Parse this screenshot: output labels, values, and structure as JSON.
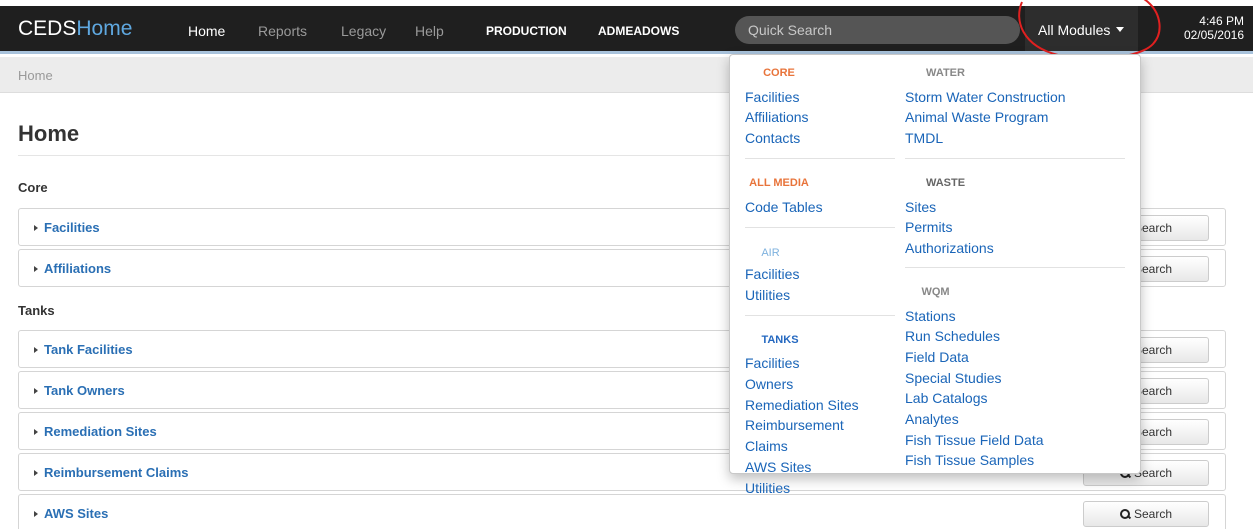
{
  "brand": {
    "part1": "CEDS",
    "part2": "Home"
  },
  "nav": {
    "home": "Home",
    "reports": "Reports",
    "legacy": "Legacy",
    "help": "Help",
    "environment": "PRODUCTION",
    "user": "ADMEADOWS"
  },
  "search": {
    "placeholder": "Quick Search"
  },
  "modules": {
    "label": "All Modules"
  },
  "clock": {
    "time": "4:46 PM",
    "date": "02/05/2016"
  },
  "breadcrumb": "Home",
  "page": {
    "title": "Home",
    "sections": [
      {
        "label": "Core",
        "panels": [
          "Facilities",
          "Affiliations"
        ]
      },
      {
        "label": "Tanks",
        "panels": [
          "Tank Facilities",
          "Tank Owners",
          "Remediation Sites",
          "Reimbursement Claims",
          "AWS Sites"
        ]
      }
    ],
    "search_button": "Search"
  },
  "dropdown": {
    "core": {
      "title": "CORE",
      "items": [
        "Facilities",
        "Affiliations",
        "Contacts"
      ]
    },
    "all_media": {
      "title": "ALL MEDIA",
      "items": [
        "Code Tables"
      ]
    },
    "air": {
      "title": "AIR",
      "items": [
        "Facilities",
        "Utilities"
      ]
    },
    "tanks": {
      "title": "TANKS",
      "items": [
        "Facilities",
        "Owners",
        "Remediation Sites",
        "Reimbursement",
        "Claims",
        "AWS Sites",
        "Utilities"
      ]
    },
    "water": {
      "title": "WATER",
      "items": [
        "Storm Water Construction",
        "Animal Waste Program",
        "TMDL"
      ]
    },
    "waste": {
      "title": "WASTE",
      "items": [
        "Sites",
        "Permits",
        "Authorizations"
      ]
    },
    "wqm": {
      "title": "WQM",
      "items": [
        "Stations",
        "Run Schedules",
        "Field Data",
        "Special Studies",
        "Lab Catalogs",
        "Analytes",
        "Fish Tissue Field Data",
        "Fish Tissue Samples"
      ]
    }
  },
  "colors": {
    "navbar": "#1f1f1f",
    "link": "#1a65b8",
    "panel_link": "#2a6fb4",
    "core_heading": "#e8743b",
    "air_heading": "#7db1de",
    "tanks_heading": "#2468c0",
    "annotation": "#e02020"
  }
}
